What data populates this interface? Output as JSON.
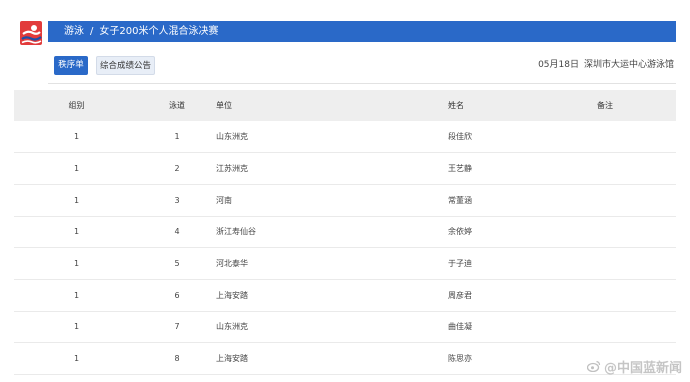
{
  "header": {
    "sport": "游泳",
    "separator": "/",
    "event": "女子200米个人混合泳决赛"
  },
  "tabs": {
    "start_list": "秩序单",
    "results_notice": "综合成绩公告"
  },
  "meta": {
    "date": "05月18日",
    "venue": "深圳市大运中心游泳馆"
  },
  "table": {
    "headers": {
      "group": "组别",
      "lane": "泳道",
      "unit": "单位",
      "name": "姓名",
      "note": "备注"
    },
    "rows": [
      {
        "group": "1",
        "lane": "1",
        "unit": "山东洲克",
        "name": "段佳欣",
        "note": ""
      },
      {
        "group": "1",
        "lane": "2",
        "unit": "江苏洲克",
        "name": "王艺静",
        "note": ""
      },
      {
        "group": "1",
        "lane": "3",
        "unit": "河南",
        "name": "常董涵",
        "note": ""
      },
      {
        "group": "1",
        "lane": "4",
        "unit": "浙江寿仙谷",
        "name": "余依婷",
        "note": ""
      },
      {
        "group": "1",
        "lane": "5",
        "unit": "河北泰华",
        "name": "于子迪",
        "note": ""
      },
      {
        "group": "1",
        "lane": "6",
        "unit": "上海安踏",
        "name": "周彦君",
        "note": ""
      },
      {
        "group": "1",
        "lane": "7",
        "unit": "山东洲克",
        "name": "曲佳凝",
        "note": ""
      },
      {
        "group": "1",
        "lane": "8",
        "unit": "上海安踏",
        "name": "陈思亦",
        "note": ""
      }
    ]
  },
  "watermark": {
    "icon": "weibo-icon",
    "text": "@中国蓝新闻"
  },
  "colors": {
    "accent": "#2a69c8",
    "logo_red": "#e23b3b"
  }
}
